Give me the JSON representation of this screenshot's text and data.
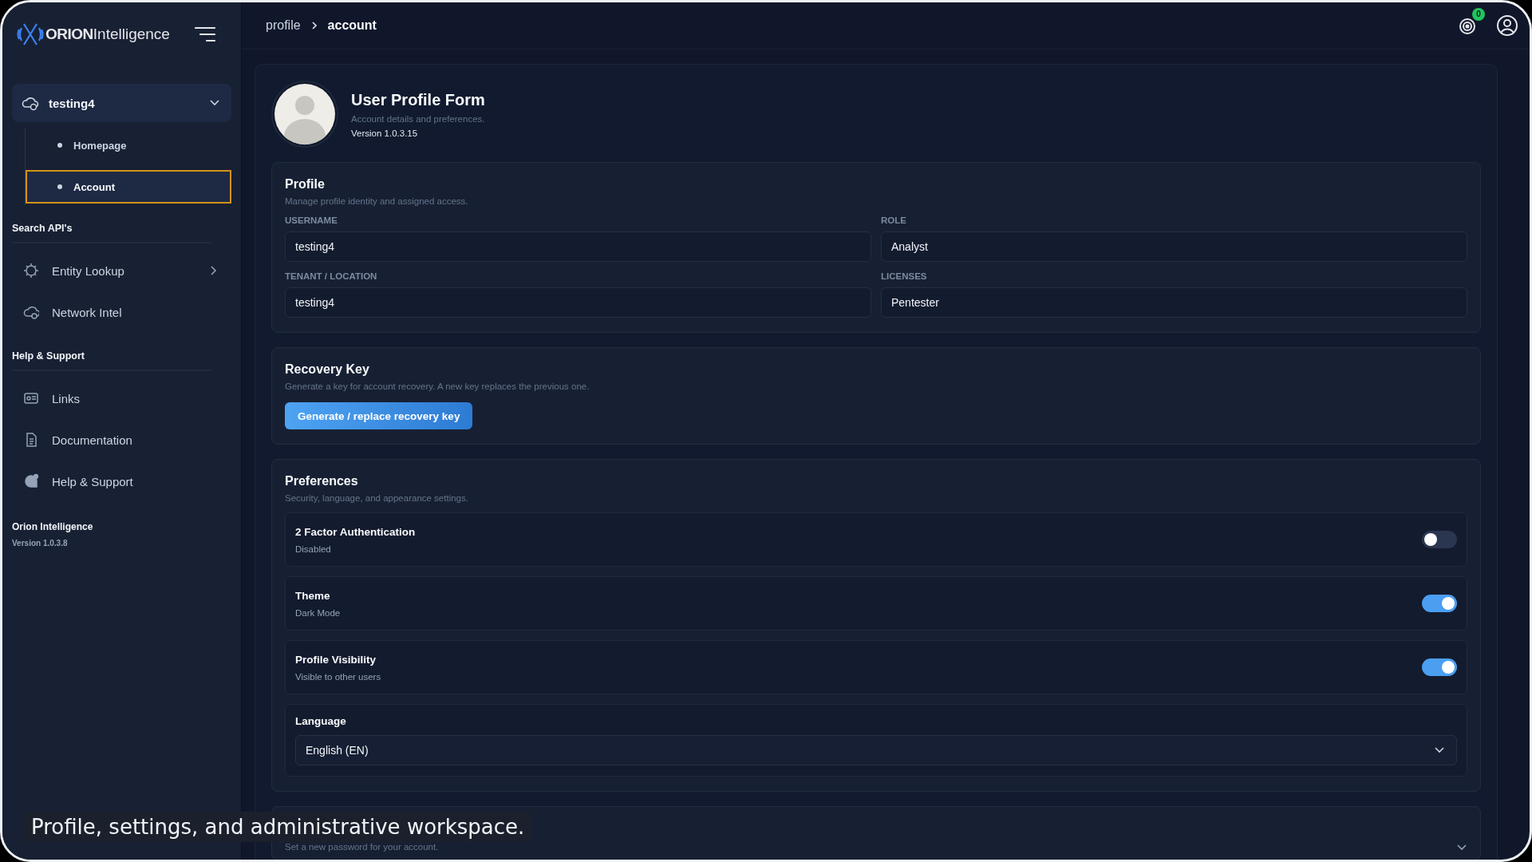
{
  "sidebar": {
    "logo": {
      "bold": "ORION",
      "light": "Intelligence"
    },
    "workspace": {
      "label": "testing4",
      "expanded": true,
      "items": [
        {
          "label": "Homepage",
          "selected": false
        },
        {
          "label": "Account",
          "selected": true
        }
      ]
    },
    "sections": [
      {
        "title": "Search API's",
        "items": [
          {
            "label": "Entity Lookup",
            "has_children": true
          },
          {
            "label": "Network Intel",
            "has_children": false
          }
        ]
      },
      {
        "title": "Help & Support",
        "items": [
          {
            "label": "Links",
            "has_children": false
          },
          {
            "label": "Documentation",
            "has_children": false
          },
          {
            "label": "Help & Support",
            "has_children": false
          }
        ]
      }
    ],
    "footer": {
      "name": "Orion Intelligence",
      "version": "Version 1.0.3.8"
    }
  },
  "breadcrumb": [
    "profile",
    "account"
  ],
  "header": {
    "notifications": "0"
  },
  "profile_header": {
    "title": "User Profile Form",
    "subtitle": "Account details and preferences.",
    "version": "Version 1.0.3.15"
  },
  "profile": {
    "title": "Profile",
    "subtitle": "Manage profile identity and assigned access.",
    "fields": [
      {
        "label": "USERNAME",
        "value": "testing4"
      },
      {
        "label": "ROLE",
        "value": "Analyst"
      },
      {
        "label": "TENANT / LOCATION",
        "value": "testing4"
      },
      {
        "label": "LICENSES",
        "value": "Pentester"
      }
    ]
  },
  "recovery": {
    "title": "Recovery Key",
    "subtitle": "Generate a key for account recovery. A new key replaces the previous one.",
    "button": "Generate / replace recovery key"
  },
  "preferences": {
    "title": "Preferences",
    "subtitle": "Security, language, and appearance settings.",
    "rows": [
      {
        "kind": "toggle",
        "title": "2 Factor Authentication",
        "detail": "Disabled",
        "on": false
      },
      {
        "kind": "toggle",
        "title": "Theme",
        "detail": "Dark Mode",
        "on": true
      },
      {
        "kind": "toggle",
        "title": "Profile Visibility",
        "detail": "Visible to other users",
        "on": true
      },
      {
        "kind": "select",
        "title": "Language",
        "value": "English (EN)"
      }
    ]
  },
  "password": {
    "subtitle": "Set a new password for your account."
  },
  "caption": "Profile, settings, and administrative workspace."
}
